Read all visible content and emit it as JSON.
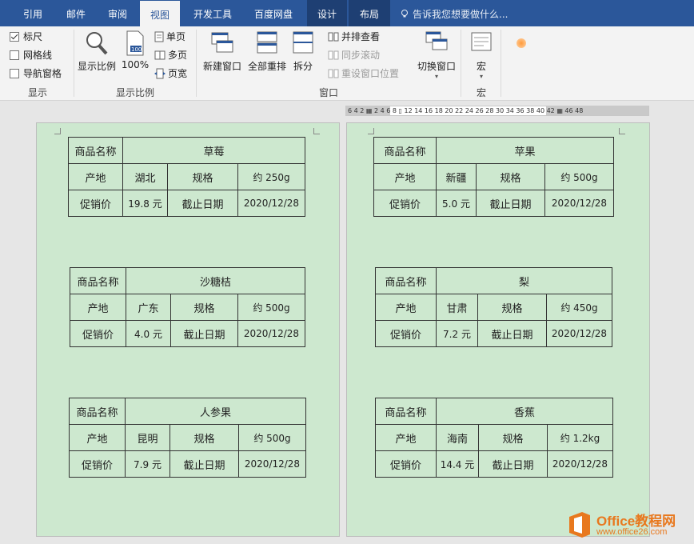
{
  "tabs": [
    "引用",
    "邮件",
    "审阅",
    "视图",
    "开发工具",
    "百度网盘",
    "设计",
    "布局"
  ],
  "active_tab": "视图",
  "tell_me": "告诉我您想要做什么...",
  "ribbon": {
    "show": {
      "ruler": "标尺",
      "gridlines": "网格线",
      "nav_pane": "导航窗格",
      "group_label": "显示",
      "ruler_checked": true,
      "gridlines_checked": false,
      "nav_checked": false
    },
    "zoom": {
      "zoom_btn": "显示比例",
      "hundred": "100%",
      "one_page": "单页",
      "multi_page": "多页",
      "page_width": "页宽",
      "group_label": "显示比例"
    },
    "window": {
      "new_window": "新建窗口",
      "arrange_all": "全部重排",
      "split": "拆分",
      "side_by_side": "并排查看",
      "sync_scroll": "同步滚动",
      "reset_pos": "重设窗口位置",
      "switch_window": "切换窗口",
      "group_label": "窗口"
    },
    "macros": {
      "macro": "宏",
      "group_label": "宏"
    }
  },
  "ruler_numbers": "6  4  2  ▦   2   4   6   8   ▯  12  14  16  18  20  22  24  26  28  30  34  36  38  40  42  ▦ 46  48",
  "labels": {
    "name": "商品名称",
    "origin": "产地",
    "spec": "规格",
    "promo": "促销价",
    "deadline": "截止日期"
  },
  "products": [
    {
      "name": "草莓",
      "origin": "湖北",
      "spec": "约 250g",
      "price": "19.8 元",
      "date": "2020/12/28"
    },
    {
      "name": "沙糖桔",
      "origin": "广东",
      "spec": "约 500g",
      "price": "4.0 元",
      "date": "2020/12/28"
    },
    {
      "name": "人参果",
      "origin": "昆明",
      "spec": "约 500g",
      "price": "7.9 元",
      "date": "2020/12/28"
    },
    {
      "name": "苹果",
      "origin": "新疆",
      "spec": "约 500g",
      "price": "5.0 元",
      "date": "2020/12/28"
    },
    {
      "name": "梨",
      "origin": "甘肃",
      "spec": "约 450g",
      "price": "7.2 元",
      "date": "2020/12/28"
    },
    {
      "name": "香蕉",
      "origin": "海南",
      "spec": "约 1.2kg",
      "price": "14.4 元",
      "date": "2020/12/28"
    }
  ],
  "logo": {
    "title": "Office教程网",
    "url": "www.office26.com"
  },
  "colors": {
    "tabbar": "#2b579a",
    "page": "#cde8cf",
    "logo": "#e8781e"
  }
}
